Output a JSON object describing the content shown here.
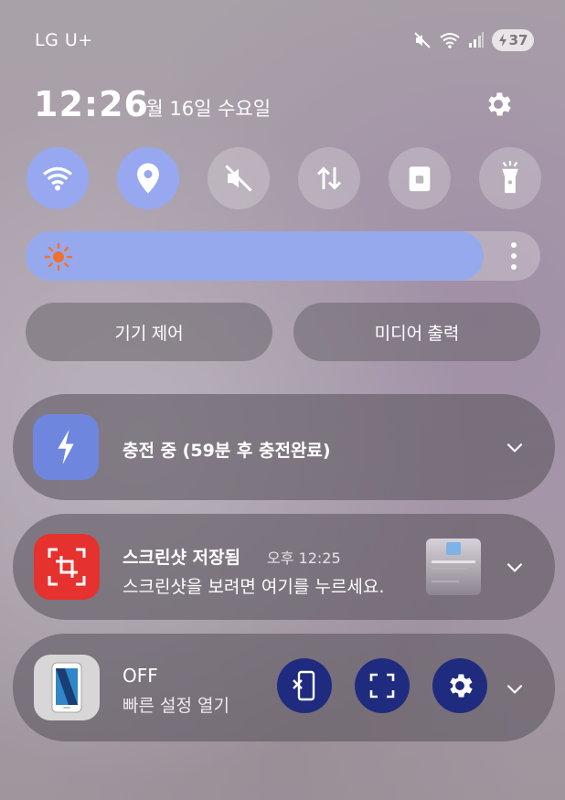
{
  "status_bar": {
    "carrier": "LG U+",
    "battery_level": "37",
    "icons": [
      "mute-icon",
      "wifi-icon",
      "signal-icon",
      "battery-icon"
    ]
  },
  "header": {
    "time": "12:26",
    "date": "7월 16일 수요일",
    "settings_icon": "gear-icon"
  },
  "quick_toggles": [
    {
      "icon": "wifi-icon",
      "active": true
    },
    {
      "icon": "location-icon",
      "active": true
    },
    {
      "icon": "mute-icon",
      "active": false
    },
    {
      "icon": "data-transfer-icon",
      "active": false
    },
    {
      "icon": "lock-icon",
      "active": false
    },
    {
      "icon": "flashlight-icon",
      "active": false
    }
  ],
  "brightness": {
    "level": 0.89,
    "icon": "sun-icon"
  },
  "buttons": {
    "device_control": "기기 제어",
    "media_output": "미디어 출력"
  },
  "notifications": [
    {
      "app_icon": "lightning-icon",
      "title": "충전 중 (59분 후 충전완료)"
    },
    {
      "app_icon": "screenshot-icon",
      "title": "스크린샷 저장됨",
      "time": "오후 12:25",
      "body": "스크린샷을 보려면 여기를 누르세요."
    },
    {
      "app_icon": "phone-icon",
      "title": "OFF",
      "subtitle": "빠른 설정 열기",
      "actions": [
        "disconnect-phone-icon",
        "screen-capture-icon",
        "gear-icon"
      ]
    }
  ],
  "colors": {
    "toggle_on": "#97a8f1",
    "brightness_fill": "#97a9ed",
    "charging_tile": "#6f86df",
    "screenshot_tile": "#e5322e",
    "action_button": "#1f2b7e"
  }
}
